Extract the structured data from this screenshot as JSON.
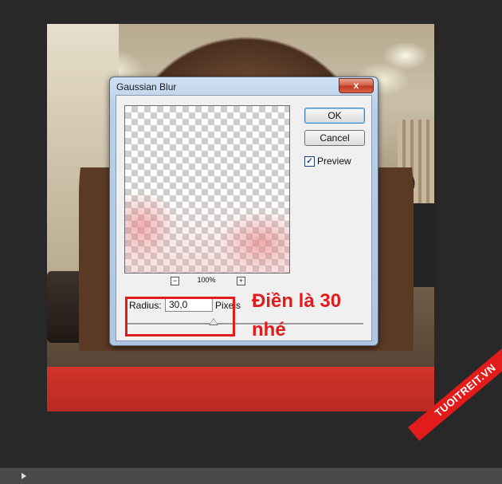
{
  "dialog": {
    "title": "Gaussian Blur",
    "close_label": "x",
    "ok_label": "OK",
    "cancel_label": "Cancel",
    "preview_label": "Preview",
    "preview_checked": true,
    "check_mark": "✓",
    "zoom_minus": "−",
    "zoom_plus": "+",
    "zoom_level": "100%",
    "radius_label": "Radius:",
    "radius_value": "30,0",
    "unit_label": "Pixels",
    "slider_fraction": 0.37
  },
  "annotation": {
    "text": "Điền là 30 nhé",
    "color": "#e21b1b"
  },
  "watermark": "TUOITREIT.VN",
  "icons": {
    "play": "play-icon"
  }
}
